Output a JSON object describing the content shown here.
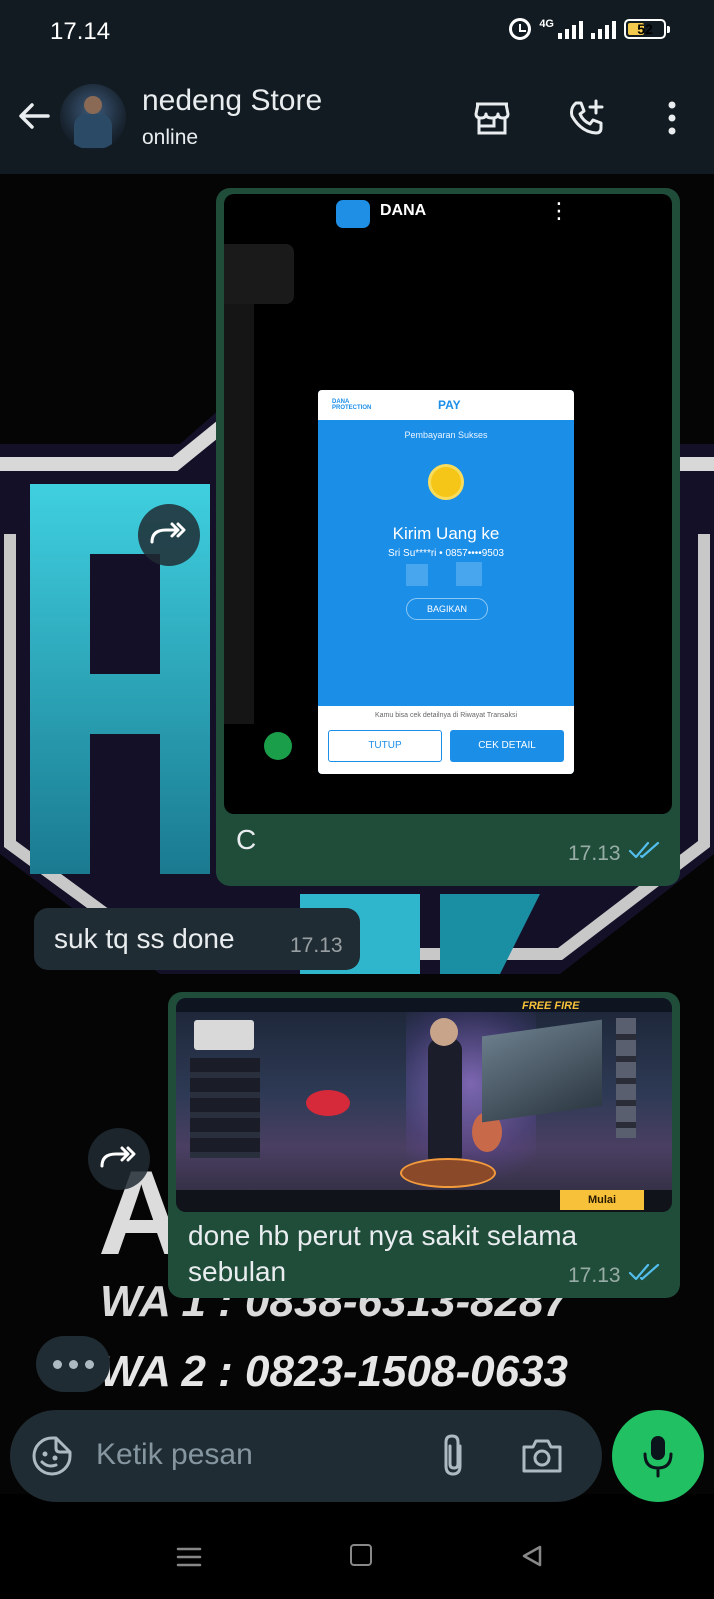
{
  "status_bar": {
    "time": "17.14",
    "network": "4G",
    "battery": "52"
  },
  "header": {
    "name": "nedeng Store",
    "status": "online"
  },
  "messages": [
    {
      "type": "image",
      "direction": "outgoing",
      "caption": "C",
      "time": "17.13",
      "read": true,
      "image": {
        "app_name": "DANA",
        "brand_protection": "DANA PROTECTION",
        "brand_pay": "PAY",
        "heading": "Pembayaran Sukses",
        "title": "Kirim Uang ke",
        "recipient": "Sri Su****ri • 0857••••9503",
        "share_label": "BAGIKAN",
        "footer_note": "Kamu bisa cek detailnya di Riwayat Transaksi",
        "button_close": "TUTUP",
        "button_detail": "CEK DETAIL"
      }
    },
    {
      "type": "text",
      "direction": "incoming",
      "text": "suk tq ss done",
      "time": "17.13"
    },
    {
      "type": "image",
      "direction": "outgoing",
      "caption": "done hb perut nya sakit selama sebulan",
      "caption_line1": "done hb perut nya sakit selama",
      "caption_line2": "sebulan",
      "time": "17.13",
      "read": true,
      "image": {
        "game_logo": "FREE FIRE",
        "start_button": "Mulai"
      }
    }
  ],
  "wallpaper": {
    "wa_line": "WA 2 : 0823-1508-0633"
  },
  "input": {
    "placeholder": "Ketik pesan"
  },
  "colors": {
    "header_bg": "#111b21",
    "bubble_out": "#005c4b",
    "bubble_in": "#202c33",
    "accent_green": "#21c063",
    "tick_blue": "#53bdeb"
  }
}
